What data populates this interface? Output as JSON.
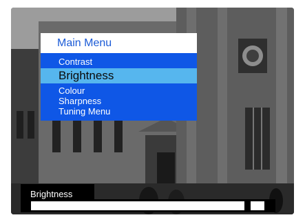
{
  "menu": {
    "title": "Main Menu",
    "items": [
      {
        "label": "Contrast",
        "selected": false
      },
      {
        "label": "Brightness",
        "selected": true
      },
      {
        "label": "Colour",
        "selected": false
      },
      {
        "label": "Sharpness",
        "selected": false
      },
      {
        "label": "Tuning Menu",
        "selected": false
      }
    ]
  },
  "adjust": {
    "label": "Brightness",
    "level": 0.92
  },
  "colors": {
    "menu_blue": "#0f57e6",
    "highlight": "#56b6ee",
    "title_text": "#1a5ad6"
  }
}
